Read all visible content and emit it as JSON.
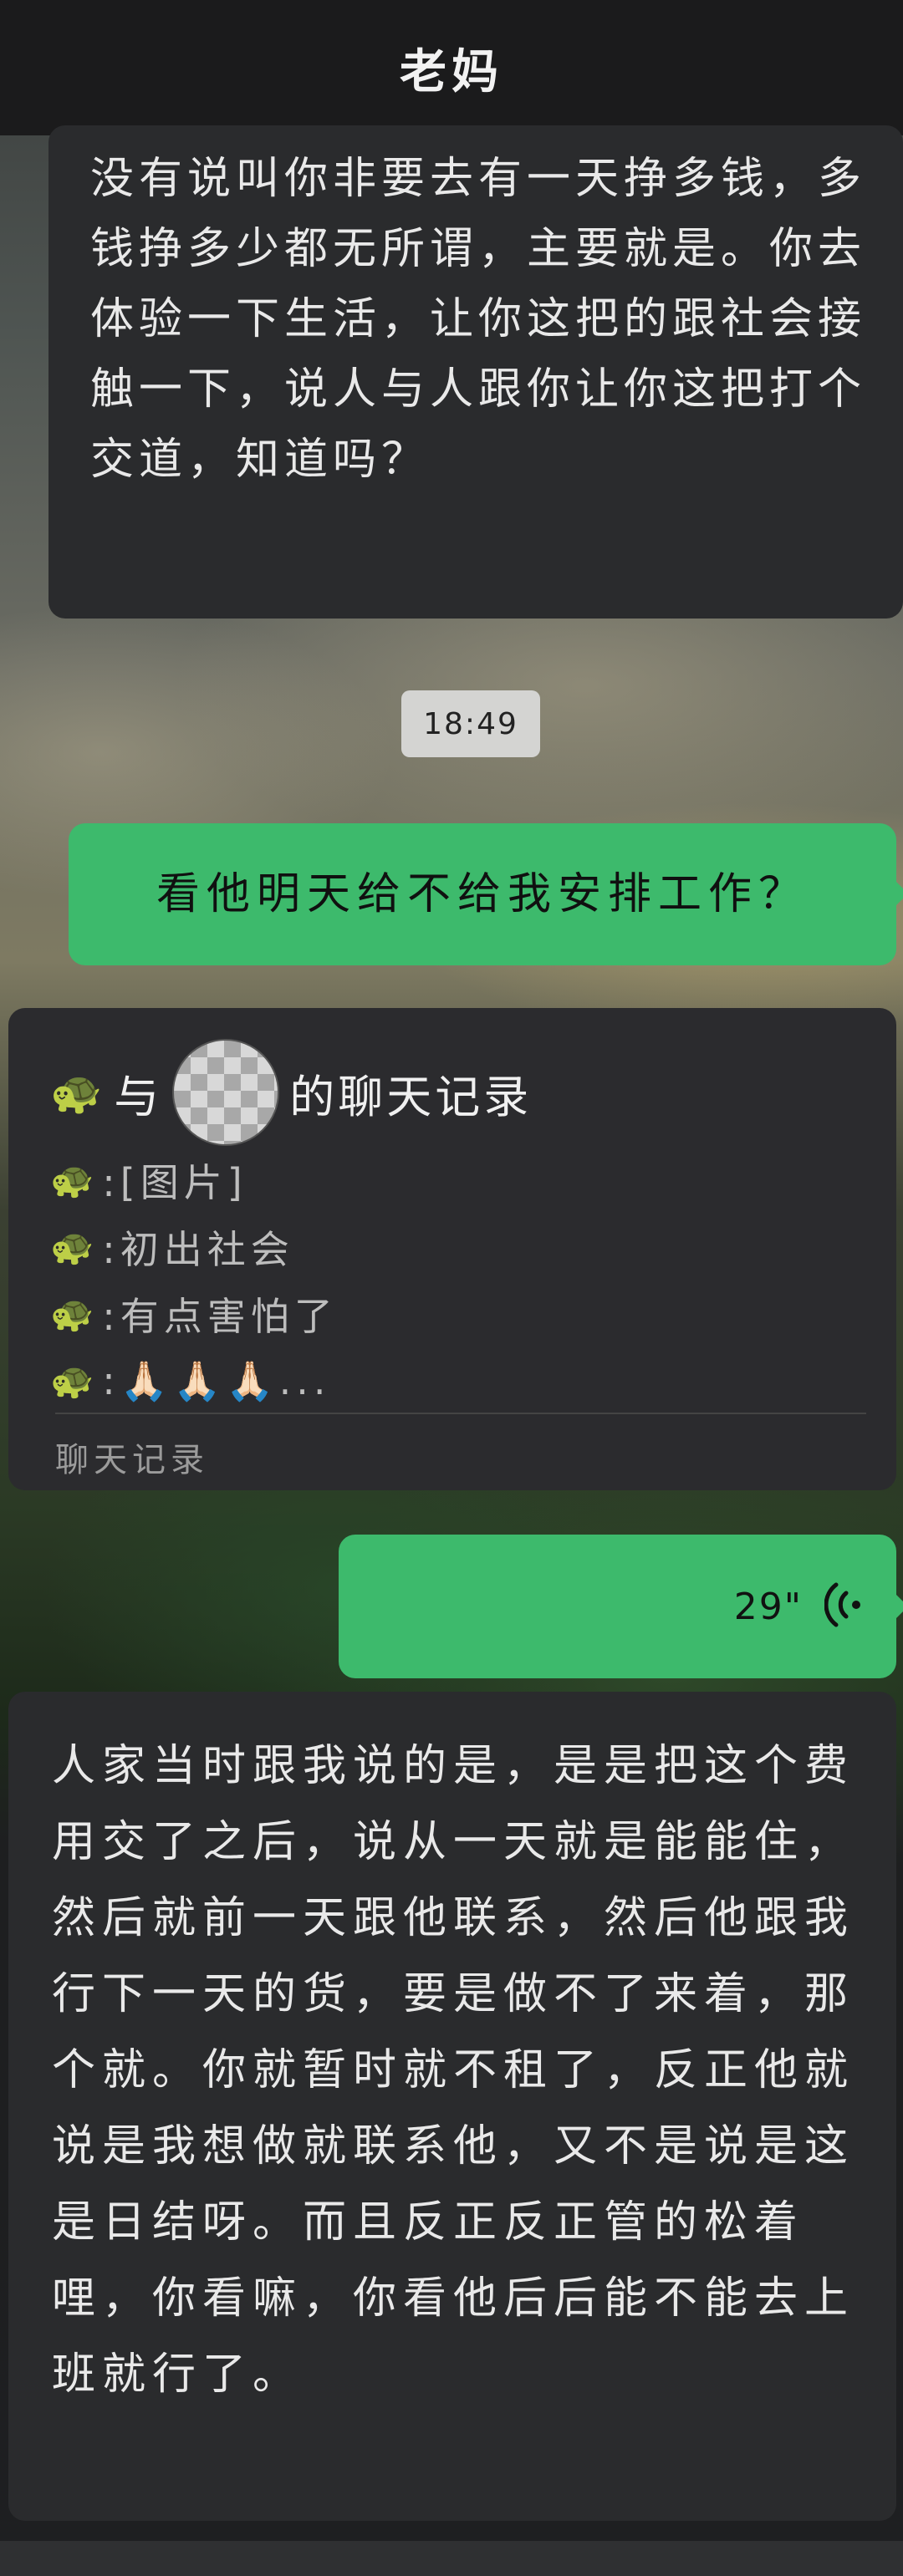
{
  "header": {
    "title": "老妈"
  },
  "messages": {
    "m1": "没有说叫你非要去有一天挣多钱，多钱挣多少都无所谓，主要就是。你去体验一下生活，让你这把的跟社会接触一下，说人与人跟你让你这把打个交道，知道吗？",
    "time": "18:49",
    "m2": "看他明天给不给我安排工作？",
    "voice_duration": "29\"",
    "m4": "人家当时跟我说的是，是是把这个费用交了之后，说从一天就是能能住，然后就前一天跟他联系，然后他跟我行下一天的货，要是做不了来着，那个就。你就暂时就不租了，反正他就说是我想做就联系他，又不是说是这是日结呀。而且反正反正管的松着哩，你看嘛，你看他后后能不能去上班就行了。"
  },
  "card": {
    "title_prefix": "与",
    "title_suffix": "的聊天记录",
    "lines": [
      ":[图片]",
      ":初出社会",
      ":有点害怕了",
      ":🙏🏻🙏🏻🙏🏻..."
    ],
    "footer": "聊天记录",
    "turtle": "🐢"
  },
  "colors": {
    "incoming": "#2a2b2d",
    "outgoing": "#3dba6c",
    "header": "#1b1b1c"
  }
}
